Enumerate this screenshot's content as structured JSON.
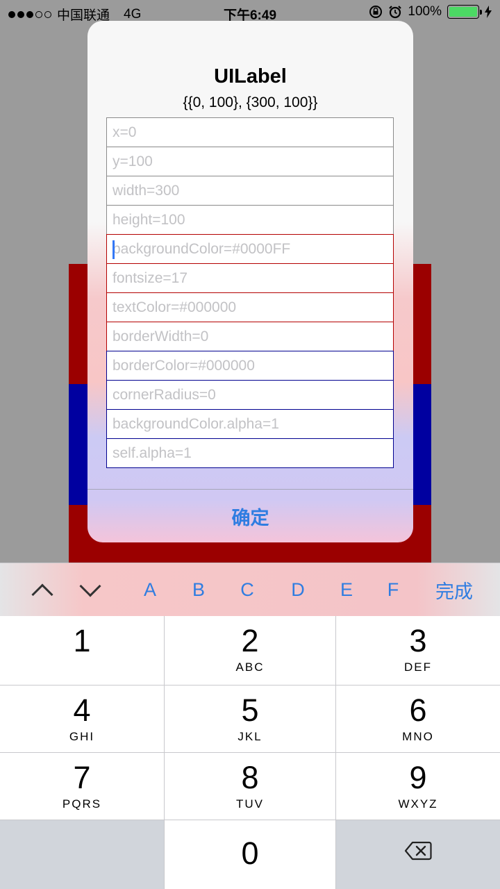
{
  "status_bar": {
    "carrier": "中国联通",
    "network": "4G",
    "time": "下午6:49",
    "battery": "100%",
    "battery_level": 1.0,
    "battery_color": "#4cd964"
  },
  "preview": {
    "colors": {
      "red": "#9b0000",
      "blue": "#0000a0"
    }
  },
  "alert": {
    "title": "UILabel",
    "message": "{{0, 100}, {300, 100}}",
    "fields": [
      {
        "placeholder": "x=0"
      },
      {
        "placeholder": "y=100"
      },
      {
        "placeholder": "width=300"
      },
      {
        "placeholder": "height=100"
      },
      {
        "placeholder": "backgroundColor=#0000FF"
      },
      {
        "placeholder": "fontsize=17"
      },
      {
        "placeholder": "textColor=#000000"
      },
      {
        "placeholder": "borderWidth=0"
      },
      {
        "placeholder": "borderColor=#000000"
      },
      {
        "placeholder": "cornerRadius=0"
      },
      {
        "placeholder": "backgroundColor.alpha=1"
      },
      {
        "placeholder": "self.alpha=1"
      }
    ],
    "confirm_label": "确定",
    "accent_color": "#2f7de1"
  },
  "keyboard_toolbar": {
    "prev_icon": "chevron-up-icon",
    "next_icon": "chevron-down-icon",
    "hex_keys": [
      "A",
      "B",
      "C",
      "D",
      "E",
      "F"
    ],
    "done_label": "完成"
  },
  "keypad": {
    "keys": [
      {
        "num": "1",
        "letters": ""
      },
      {
        "num": "2",
        "letters": "ABC"
      },
      {
        "num": "3",
        "letters": "DEF"
      },
      {
        "num": "4",
        "letters": "GHI"
      },
      {
        "num": "5",
        "letters": "JKL"
      },
      {
        "num": "6",
        "letters": "MNO"
      },
      {
        "num": "7",
        "letters": "PQRS"
      },
      {
        "num": "8",
        "letters": "TUV"
      },
      {
        "num": "9",
        "letters": "WXYZ"
      },
      {
        "num": "0",
        "letters": ""
      }
    ],
    "delete_icon": "backspace-icon"
  }
}
